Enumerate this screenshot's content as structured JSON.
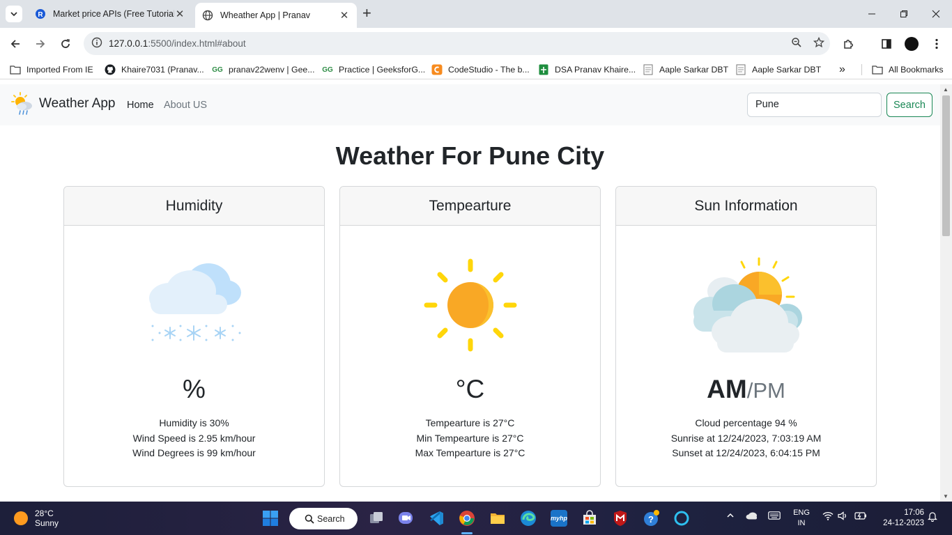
{
  "browser": {
    "tabs": [
      {
        "title": "Market price APIs (Free Tutorial",
        "active": false
      },
      {
        "title": "Wheather App | Pranav",
        "active": true
      }
    ],
    "url_host": "127.0.0.1",
    "url_rest": ":5500/index.html#about",
    "bookmarks": [
      {
        "label": "Imported From IE",
        "icon": "folder-icon"
      },
      {
        "label": "Khaire7031 (Pranav...",
        "icon": "github-icon"
      },
      {
        "label": "pranav22wenv | Gee...",
        "icon": "geeksforgeeks-icon"
      },
      {
        "label": "Practice | GeeksforG...",
        "icon": "geeksforgeeks-icon"
      },
      {
        "label": "CodeStudio - The b...",
        "icon": "codestudio-icon"
      },
      {
        "label": "DSA Pranav Khaire...",
        "icon": "sheets-icon"
      },
      {
        "label": "Aaple Sarkar DBT",
        "icon": "page-icon"
      },
      {
        "label": "Aaple Sarkar DBT",
        "icon": "page-icon"
      }
    ],
    "more_bookmarks": "»",
    "all_bookmarks": "All Bookmarks"
  },
  "navbar": {
    "brand": "Weather App",
    "links": [
      {
        "label": "Home"
      },
      {
        "label": "About US"
      }
    ],
    "search_value": "Pune",
    "search_button": "Search"
  },
  "main": {
    "heading": "Weather For Pune City",
    "cards": [
      {
        "title": "Humidity",
        "icon": "snow-cloud-icon",
        "value": "%",
        "value_sub": "",
        "lines": [
          "Humidity is 30%",
          "Wind Speed is 2.95 km/hour",
          "Wind Degrees is 99 km/hour"
        ]
      },
      {
        "title": "Tempearture",
        "icon": "sun-icon",
        "value": "°C",
        "value_sub": "",
        "lines": [
          "Tempearture is 27°C",
          "Min Tempearture is 27°C",
          "Max Tempearture is 27°C"
        ]
      },
      {
        "title": "Sun Information",
        "icon": "partly-cloudy-icon",
        "value": "AM",
        "value_sub": "/PM",
        "lines": [
          "Cloud percentage 94 %",
          "Sunrise at 12/24/2023, 7:03:19 AM",
          "Sunset at 12/24/2023, 6:04:15 PM"
        ]
      }
    ]
  },
  "taskbar": {
    "weather_temp": "28°C",
    "weather_desc": "Sunny",
    "search_label": "Search",
    "lang_line1": "ENG",
    "lang_line2": "IN",
    "time": "17:06",
    "date": "24-12-2023"
  },
  "colors": {
    "accent_green": "#198754",
    "sun_yellow": "#ffd60a",
    "sun_orange": "#f9a825",
    "cloud_blue": "#cfe8fb"
  }
}
